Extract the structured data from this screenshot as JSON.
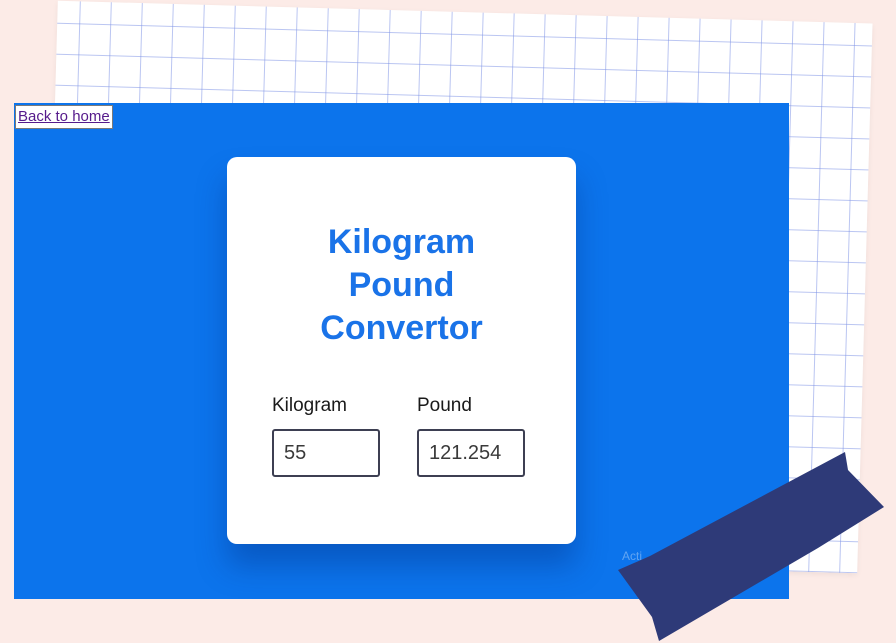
{
  "nav": {
    "back_label": "Back to home"
  },
  "converter": {
    "title_lines": [
      "Kilogram",
      "Pound",
      "Convertor"
    ],
    "kilogram_label": "Kilogram",
    "pound_label": "Pound",
    "kilogram_value": "55",
    "pound_value": "121.254"
  },
  "overlay": {
    "watermark_text": "Acti"
  },
  "colors": {
    "page_background": "#fcebe7",
    "browser_background": "#0c74ec",
    "title_color": "#1a73e8",
    "tape_color": "#2e3a78",
    "grid_line": "#8296e6"
  }
}
